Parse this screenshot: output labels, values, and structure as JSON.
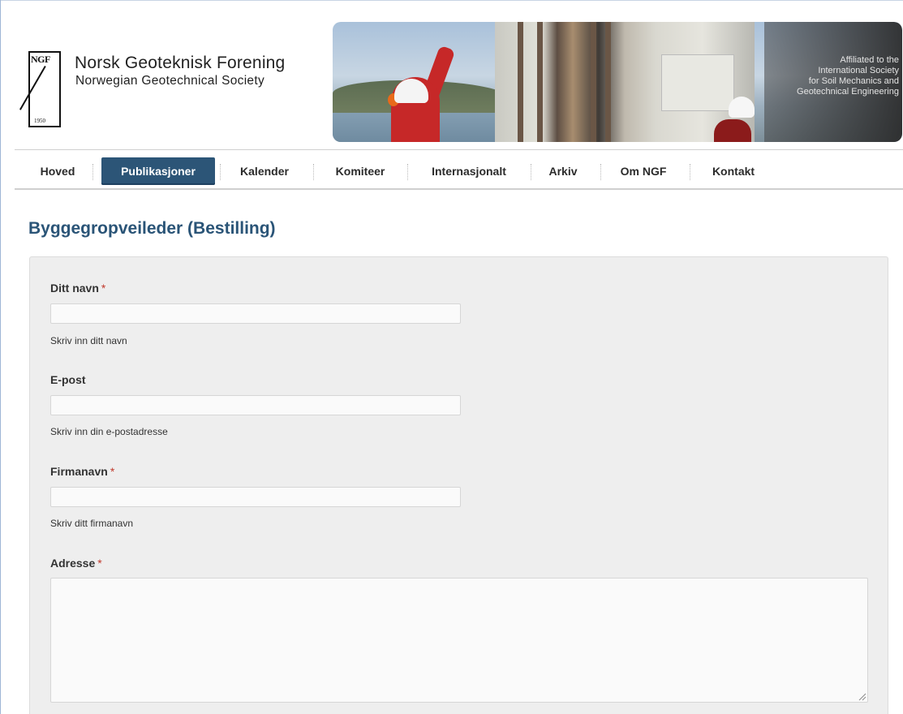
{
  "header": {
    "logo_text": "NGF",
    "logo_year": "1950",
    "society_name": "Norsk Geoteknisk Forening",
    "society_name_en": "Norwegian Geotechnical Society",
    "affiliation": [
      "Affiliated to the",
      "International Society",
      "for Soil Mechanics and",
      "Geotechnical Engineering"
    ]
  },
  "nav": {
    "items": [
      {
        "label": "Hoved",
        "active": false
      },
      {
        "label": "Publikasjoner",
        "active": true
      },
      {
        "label": "Kalender",
        "active": false
      },
      {
        "label": "Komiteer",
        "active": false
      },
      {
        "label": "Internasjonalt",
        "active": false
      },
      {
        "label": "Arkiv",
        "active": false
      },
      {
        "label": "Om NGF",
        "active": false
      },
      {
        "label": "Kontakt",
        "active": false
      }
    ]
  },
  "page": {
    "title": "Byggegropveileder (Bestilling)"
  },
  "form": {
    "required_marker": "*",
    "name": {
      "label": "Ditt navn",
      "required": true,
      "value": "",
      "help": "Skriv inn ditt navn"
    },
    "email": {
      "label": "E-post",
      "required": false,
      "value": "",
      "help": "Skriv inn din e-postadresse"
    },
    "company": {
      "label": "Firmanavn",
      "required": true,
      "value": "",
      "help": "Skriv ditt firmanavn"
    },
    "address": {
      "label": "Adresse",
      "required": true,
      "value": ""
    }
  },
  "colors": {
    "accent": "#2c5577",
    "title": "#2a5477",
    "required": "#c0392b",
    "panel": "#eeeeee"
  }
}
